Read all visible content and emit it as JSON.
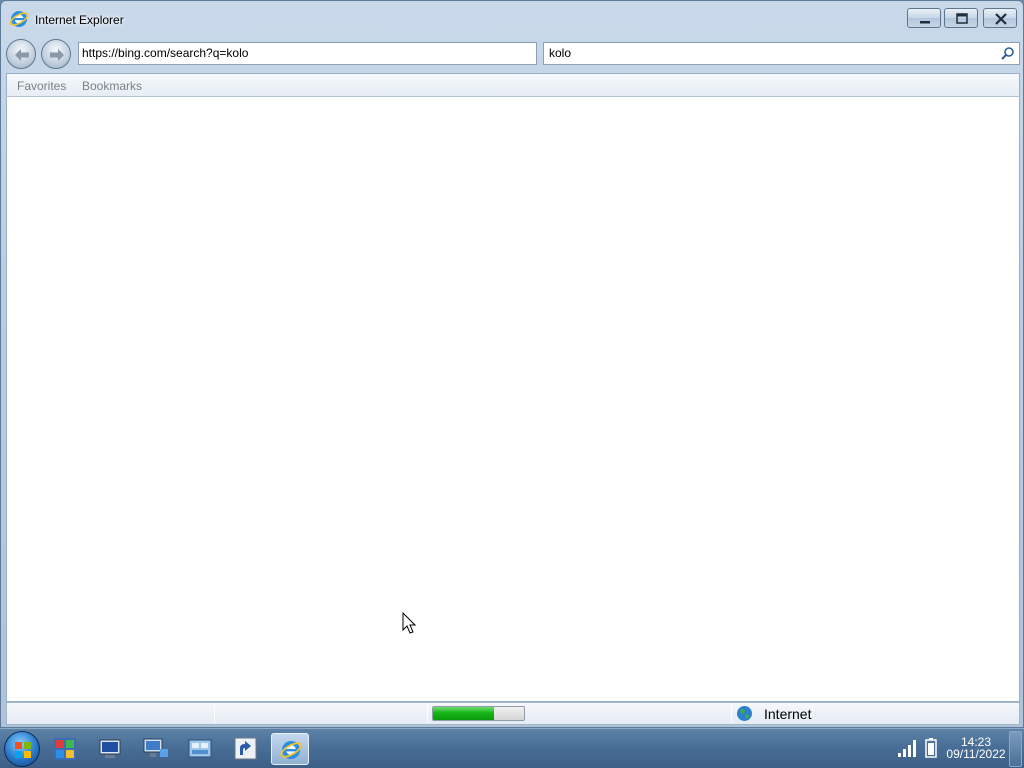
{
  "window": {
    "title": "Internet Explorer"
  },
  "toolbar": {
    "address": "https://bing.com/search?q=kolo",
    "search": "kolo"
  },
  "favorites_bar": {
    "items": [
      {
        "label": "Favorites"
      },
      {
        "label": "Bookmarks"
      }
    ]
  },
  "status_bar": {
    "progress_percent": 67,
    "zone": "Internet"
  },
  "taskbar": {
    "clock_time": "14:23",
    "clock_date": "09/11/2022"
  }
}
